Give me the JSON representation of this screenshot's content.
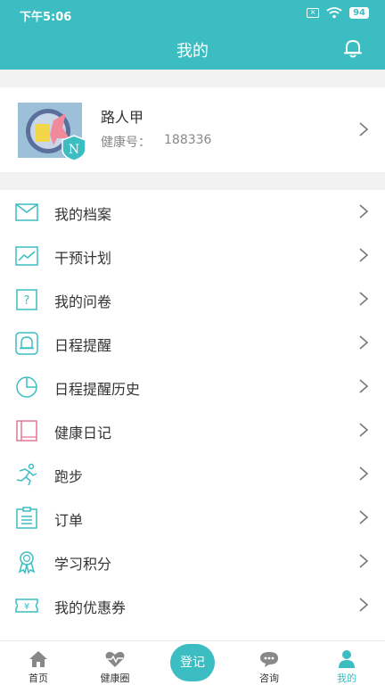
{
  "status_bar": {
    "time": "下午5:06",
    "battery": "94"
  },
  "header": {
    "title": "我的",
    "accent_color": "#3bbdc1"
  },
  "profile": {
    "name": "路人甲",
    "id_label": "健康号：",
    "id_value": "188336"
  },
  "menu": [
    {
      "label": "我的档案",
      "icon": "envelope-icon"
    },
    {
      "label": "干预计划",
      "icon": "trend-chart-icon"
    },
    {
      "label": "我的问卷",
      "icon": "question-doc-icon"
    },
    {
      "label": "日程提醒",
      "icon": "bell-icon"
    },
    {
      "label": "日程提醒历史",
      "icon": "pie-clock-icon"
    },
    {
      "label": "健康日记",
      "icon": "diary-book-icon"
    },
    {
      "label": "跑步",
      "icon": "runner-icon"
    },
    {
      "label": "订单",
      "icon": "order-list-icon"
    },
    {
      "label": "学习积分",
      "icon": "award-ribbon-icon"
    },
    {
      "label": "我的优惠券",
      "icon": "coupon-icon"
    }
  ],
  "tabbar": {
    "tabs": [
      {
        "label": "首页",
        "icon": "home-icon"
      },
      {
        "label": "健康圈",
        "icon": "heart-pulse-icon"
      },
      {
        "label": "咨询",
        "icon": "chat-icon"
      },
      {
        "label": "我的",
        "icon": "user-icon"
      }
    ],
    "center_button": "登记",
    "active_color": "#3bbdc1"
  }
}
